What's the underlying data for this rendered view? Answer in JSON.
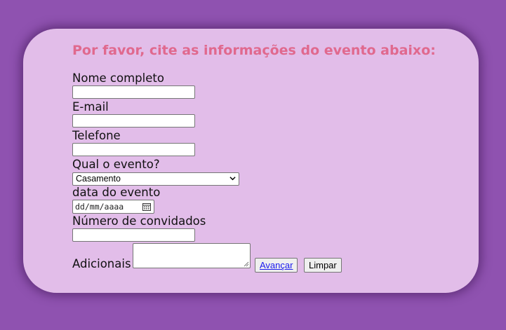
{
  "form": {
    "title": "Por favor, cite as informações do evento abaixo:",
    "name_label": "Nome completo",
    "name_value": "",
    "email_label": "E-mail",
    "email_value": "",
    "phone_label": "Telefone",
    "phone_value": "",
    "event_label": "Qual o evento?",
    "event_selected": "Casamento",
    "date_label": "data do evento",
    "date_placeholder": "dd/mm/aaaa",
    "guests_label": "Número de convidados",
    "guests_value": "",
    "extra_label": "Adicionais",
    "extra_value": "",
    "next_button": "Avançar",
    "clear_button": "Limpar"
  },
  "colors": {
    "page_background": "#8f52b0",
    "card_background": "#e2bde9",
    "title": "#e0698e",
    "link": "#1a1aee"
  }
}
